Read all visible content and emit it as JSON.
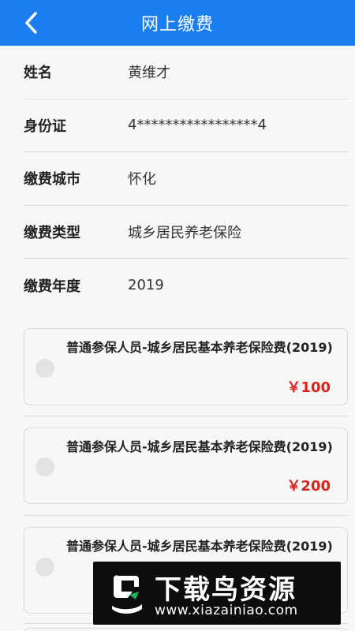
{
  "header": {
    "title": "网上缴费"
  },
  "info": [
    {
      "label": "姓名",
      "value": "黄维才"
    },
    {
      "label": "身份证",
      "value": "4*****************4"
    },
    {
      "label": "缴费城市",
      "value": "怀化"
    },
    {
      "label": "缴费类型",
      "value": "城乡居民养老保险"
    },
    {
      "label": "缴费年度",
      "value": "2019"
    }
  ],
  "fees": [
    {
      "name": "普通参保人员-城乡居民基本养老保险费(2019)",
      "price": "￥100"
    },
    {
      "name": "普通参保人员-城乡居民基本养老保险费(2019)",
      "price": "￥200"
    },
    {
      "name": "普通参保人员-城乡居民基本养老保险费(2019)",
      "price": ""
    }
  ],
  "watermark": {
    "title": "下载鸟资源",
    "url": "www.xiazainiao.com"
  },
  "colors": {
    "header_bg": "#1a7ef0",
    "price": "#d9241e"
  }
}
